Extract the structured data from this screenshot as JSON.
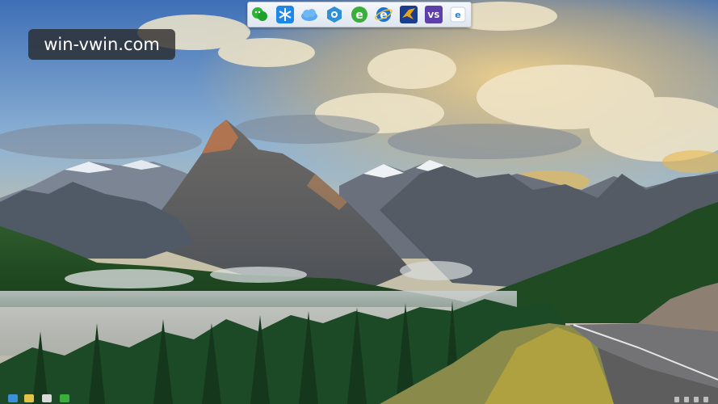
{
  "watermark": {
    "text": "win-vwin.com"
  },
  "dock": {
    "icons": [
      {
        "name": "wechat-icon",
        "color": "#2fb536"
      },
      {
        "name": "snowflake-app-icon",
        "color": "#1f87e8"
      },
      {
        "name": "cloud-icon",
        "color": "#5aa9f0"
      },
      {
        "name": "hex-gear-icon",
        "color": "#2f90d8"
      },
      {
        "name": "browser-e-green-icon",
        "color": "#3aae3a"
      },
      {
        "name": "internet-explorer-icon",
        "color": "#1a73d9"
      },
      {
        "name": "bird-app-icon",
        "color": "#e8a417"
      },
      {
        "name": "visual-studio-icon",
        "color": "#5c3fa8"
      },
      {
        "name": "small-e-icon",
        "color": "#2a7fd1"
      }
    ]
  },
  "colors": {
    "sky_top": "#4a74b8",
    "sky_mid": "#8fb4d6",
    "cloud_gold": "#e6c98a",
    "mountain": "#5b5f66",
    "forest": "#1f4a22",
    "road": "#6c6c6e"
  }
}
